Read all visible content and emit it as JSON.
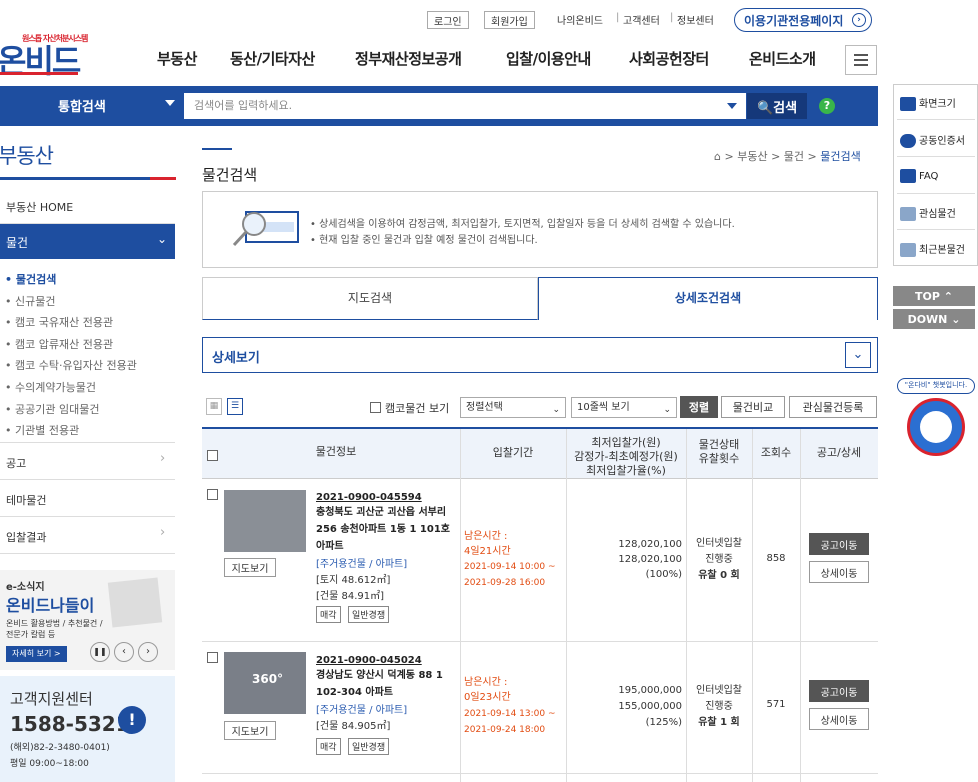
{
  "header": {
    "logo_sub": "원스톱 자산처분시스템",
    "logo": "온비드",
    "util_buttons": [
      "로그인",
      "회원가입"
    ],
    "util_links": [
      "나의온비드",
      "고객센터",
      "정보센터"
    ],
    "institution_button": "이용기관전용페이지",
    "gnb": [
      "부동산",
      "동산/기타자산",
      "정부재산정보공개",
      "입찰/이용안내",
      "사회공헌장터",
      "온비드소개"
    ]
  },
  "search": {
    "title": "통합검색",
    "placeholder": "검색어를 입력하세요.",
    "button": "검색",
    "help": "?"
  },
  "sidebar": {
    "title": "부동산",
    "home": "부동산 HOME",
    "active": "물건",
    "sub_items": [
      "물건검색",
      "신규물건",
      "캠코 국유재산 전용관",
      "캠코 압류재산 전용관",
      "캠코 수탁·유입자산 전용관",
      "수의계약가능물건",
      "공공기관 임대물건",
      "기관별 전용관"
    ],
    "menus": [
      "공고",
      "테마물건",
      "입찰결과"
    ],
    "banner1": {
      "line1": "e-소식지",
      "title": "온비드나들이",
      "desc1": "온비드 활용방법 / 추천물건 /",
      "desc2": "전문가 칼럼 등",
      "more": "자세히 보기 >"
    },
    "banner2": {
      "title": "고객지원센터",
      "phone": "1588-5321",
      "overseas": "(해외)82-2-3480-0401)",
      "hours": "평일 09:00~18:00"
    }
  },
  "content": {
    "title": "물건검색",
    "breadcrumb": [
      "부동산",
      "물건",
      "물건검색"
    ],
    "info": [
      "• 상세검색을 이용하여 감정금액, 최저입찰가, 토지면적, 입찰일자 등을 더 상세히 검색할 수 있습니다.",
      "• 현재 입찰 중인 물건과 입찰 예정 물건이 검색됩니다."
    ],
    "tabs": [
      "지도검색",
      "상세조건검색"
    ],
    "detail": "상세보기",
    "camco_check": "캠코물건 보기",
    "sort_select": "정렬선택",
    "count_select": "10줄씩 보기",
    "sort_button": "정렬",
    "compare_button": "물건비교",
    "fav_button": "관심물건등록"
  },
  "table": {
    "headers": {
      "info": "물건정보",
      "period": "입찰기간",
      "price1": "최저입찰가(원)",
      "price2": "감정가-최초예정가(원)",
      "price3": "최저입찰가율(%)",
      "status1": "물건상태",
      "status2": "유찰횟수",
      "views": "조회수",
      "notice": "공고/상세"
    },
    "rows": [
      {
        "map": "지도보기",
        "no": "2021-0900-045594",
        "addr": "충청북도 괴산군 괴산읍 서부리 256 송천아파트 1동 1 101호 아파트",
        "type": "[주거용건물 / 아파트]",
        "area1": "[토지 48.612㎡]",
        "area2": "[건물 84.91㎡]",
        "tags": [
          "매각",
          "일반경쟁"
        ],
        "remain1": "남은시간 :",
        "remain2": "4일21시간",
        "start": "2021-09-14 10:00 ~",
        "end": "2021-09-28 16:00",
        "min_price": "128,020,100",
        "appraisal": "128,020,100",
        "rate": "(100%)",
        "status": "인터넷입찰",
        "state": "진행중",
        "fails": "유찰 0 회",
        "views": "858",
        "notice_btn": "공고이동",
        "detail_btn": "상세이동"
      },
      {
        "map": "지도보기",
        "no": "2021-0900-045024",
        "addr": "경상남도 양산시 덕계동 88 1 102-304 아파트",
        "type": "[주거용건물 / 아파트]",
        "area1": "[건물 84.905㎡]",
        "area2": "",
        "tags": [
          "매각",
          "일반경쟁"
        ],
        "remain1": "남은시간 :",
        "remain2": "0일23시간",
        "start": "2021-09-14 13:00 ~",
        "end": "2021-09-24 18:00",
        "min_price": "195,000,000",
        "appraisal": "155,000,000",
        "rate": "(125%)",
        "status": "인터넷입찰",
        "state": "진행중",
        "fails": "유찰 1 회",
        "views": "571",
        "notice_btn": "공고이동",
        "detail_btn": "상세이동",
        "thumb_badge": "360°"
      }
    ]
  },
  "quick": {
    "items": [
      "화면크기",
      "공동인증서",
      "FAQ",
      "관심물건",
      "최근본물건"
    ],
    "top": "TOP ⌃",
    "down": "DOWN ⌄",
    "chatbot": "\"온다비\" 챗봇입니다."
  },
  "colors": {
    "brand": "#1e4ea0",
    "accent": "#d9232e",
    "time": "#e24c12"
  }
}
